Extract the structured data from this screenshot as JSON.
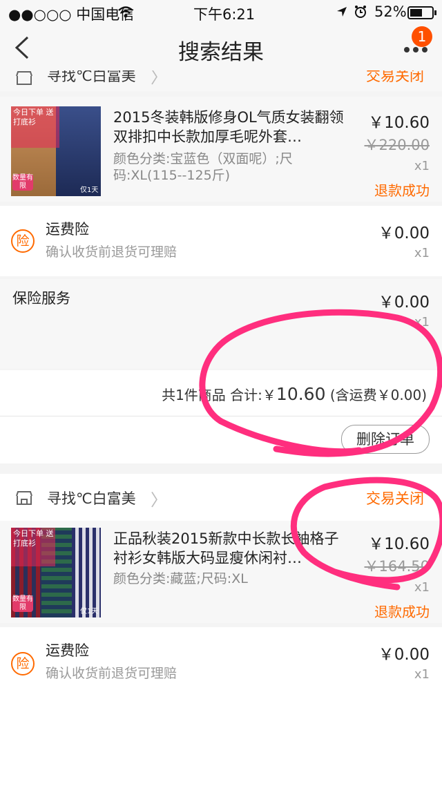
{
  "status_bar": {
    "carrier": "●●○○○ 中国电信",
    "time": "下午6:21",
    "battery": "52%"
  },
  "nav": {
    "title": "搜索结果",
    "badge": "1"
  },
  "order1": {
    "shop": "寻找℃白富美",
    "status": "交易关闭",
    "item": {
      "title": "2015冬装韩版修身OL气质女装翻领双排扣中长款加厚毛呢外套…",
      "sku": "颜色分类:宝蓝色（双面呢）;尺码:XL(115--125斤)",
      "price": "￥10.60",
      "original_price": "￥220.00",
      "qty": "x1",
      "refund": "退款成功",
      "thumb_top": "今日下单 送 打底衫",
      "thumb_tag": "数量有限",
      "thumb_corner": "仅1天"
    },
    "insurance": {
      "icon": "险",
      "title": "运费险",
      "desc": "确认收货前退货可理赔",
      "price": "￥0.00",
      "qty": "x1"
    },
    "service": {
      "title": "保险服务",
      "price": "￥0.00",
      "qty": "x1"
    },
    "summary": {
      "count": "共1件商品",
      "total_label": "合计:",
      "currency": "￥",
      "total_value": "10.60",
      "shipping": "(含运费￥0.00)"
    },
    "delete_button": "删除订单"
  },
  "order2": {
    "shop": "寻找℃白富美",
    "status": "交易关闭",
    "item": {
      "title": "正品秋装2015新款中长款长袖格子衬衫女韩版大码显瘦休闲衬…",
      "sku": "颜色分类:藏蓝;尺码:XL",
      "price": "￥10.60",
      "original_price": "￥164.50",
      "qty": "x1",
      "refund": "退款成功",
      "thumb_top": "今日下单 送 打底衫",
      "thumb_tag": "数量有限",
      "thumb_corner": "仅1天"
    },
    "insurance": {
      "icon": "险",
      "title": "运费险",
      "desc": "确认收货前退货可理赔",
      "price": "￥0.00",
      "qty": "x1"
    }
  },
  "colors": {
    "accent": "#ff6a00",
    "annotation": "#ff2e7e",
    "badge": "#ff5000"
  }
}
